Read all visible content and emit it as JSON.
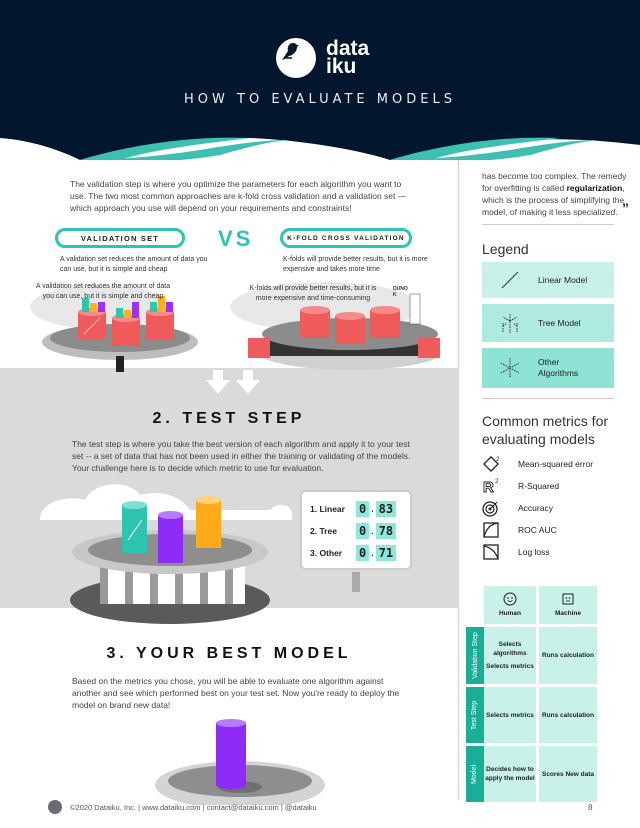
{
  "header": {
    "brand_line1": "data",
    "brand_line2": "iku",
    "title": "HOW TO EVALUATE MODELS",
    "colors": {
      "navy": "#02172e",
      "teal": "#3dbfb2"
    }
  },
  "validation_section": {
    "intro": "The validation step is where you optimize the parameters for each algorithm you want to use. The two most common approaches are k-fold cross validation and a validation set — which approach you use will depend on your requirements and constraints!",
    "left_pill": "VALIDATION SET",
    "vs": "VS",
    "right_pill": "K-FOLD CROSS VALIDATION",
    "left_desc": "A validation set reduces the amount of data you can use, but it is simple and cheap",
    "right_desc": "K-folds will provide better results, but it is more expensive and takes more time",
    "left_caption": "A validation set reduces the amount of data you can use, but it is simple and cheap",
    "right_caption": "K-folds will provide better results, but it is more expensive and time-consuming",
    "sign_text": "DUNO K"
  },
  "test_section": {
    "title": "2. TEST STEP",
    "text": "The test step is where you take the best version of each algorithm and apply it to your test set -- a set of data that has not been used in either the training or validating of the models. Your challenge here is to decide which metric to use for evaluation.",
    "scores": [
      {
        "label": "1. Linear",
        "int": "0",
        "dec": "83"
      },
      {
        "label": "2. Tree",
        "int": "0",
        "dec": "78"
      },
      {
        "label": "3. Other",
        "int": "0",
        "dec": "71"
      }
    ]
  },
  "best_model_section": {
    "title": "3. YOUR BEST MODEL",
    "text": "Based on the metrics you chose, you will be able to evaluate one algorithm against another and see which performed best on your test set. Now you're ready to deploy the model on brand new data!"
  },
  "sidebar": {
    "quote_pre": "has become too complex. The remedy for overfitting is called ",
    "quote_bold": "regularization",
    "quote_post": ", which is the process of simplifying the model, of making it less specialized.",
    "quote_mark": "”",
    "legend_title": "Legend",
    "legend": [
      {
        "icon": "linear-model-icon",
        "label": "Linear Model",
        "color": "#c8f1ea"
      },
      {
        "icon": "tree-model-icon",
        "label": "Tree Model",
        "color": "#aeeae0"
      },
      {
        "icon": "other-algorithms-icon",
        "label": "Other Algorithms",
        "color": "#8ee3d5"
      }
    ],
    "metrics_title": "Common metrics for evaluating models",
    "metrics": [
      {
        "icon": "diamond-squared-icon",
        "label": "Mean-squared error"
      },
      {
        "icon": "r-squared-icon",
        "label": "R-Squared"
      },
      {
        "icon": "target-icon",
        "label": "Accuracy"
      },
      {
        "icon": "roc-curve-icon",
        "label": "ROC AUC"
      },
      {
        "icon": "log-loss-curve-icon",
        "label": "Log loss"
      }
    ],
    "roles_table": {
      "columns": [
        "Human",
        "Machine"
      ],
      "rows": [
        {
          "label": "Validation Step",
          "human": [
            "Selects algorithms",
            "Selects metrics"
          ],
          "machine": "Runs calculation"
        },
        {
          "label": "Test Step",
          "human": [
            "Selects metrics"
          ],
          "machine": "Runs calculation"
        },
        {
          "label": "Model",
          "human": [
            "Decides how to apply the model"
          ],
          "machine": "Scores New data"
        }
      ]
    }
  },
  "footer": {
    "text": "©2020 Dataiku, Inc. | www.dataiku.com | contact@dataiku.com | @dataiku",
    "page": "8"
  }
}
